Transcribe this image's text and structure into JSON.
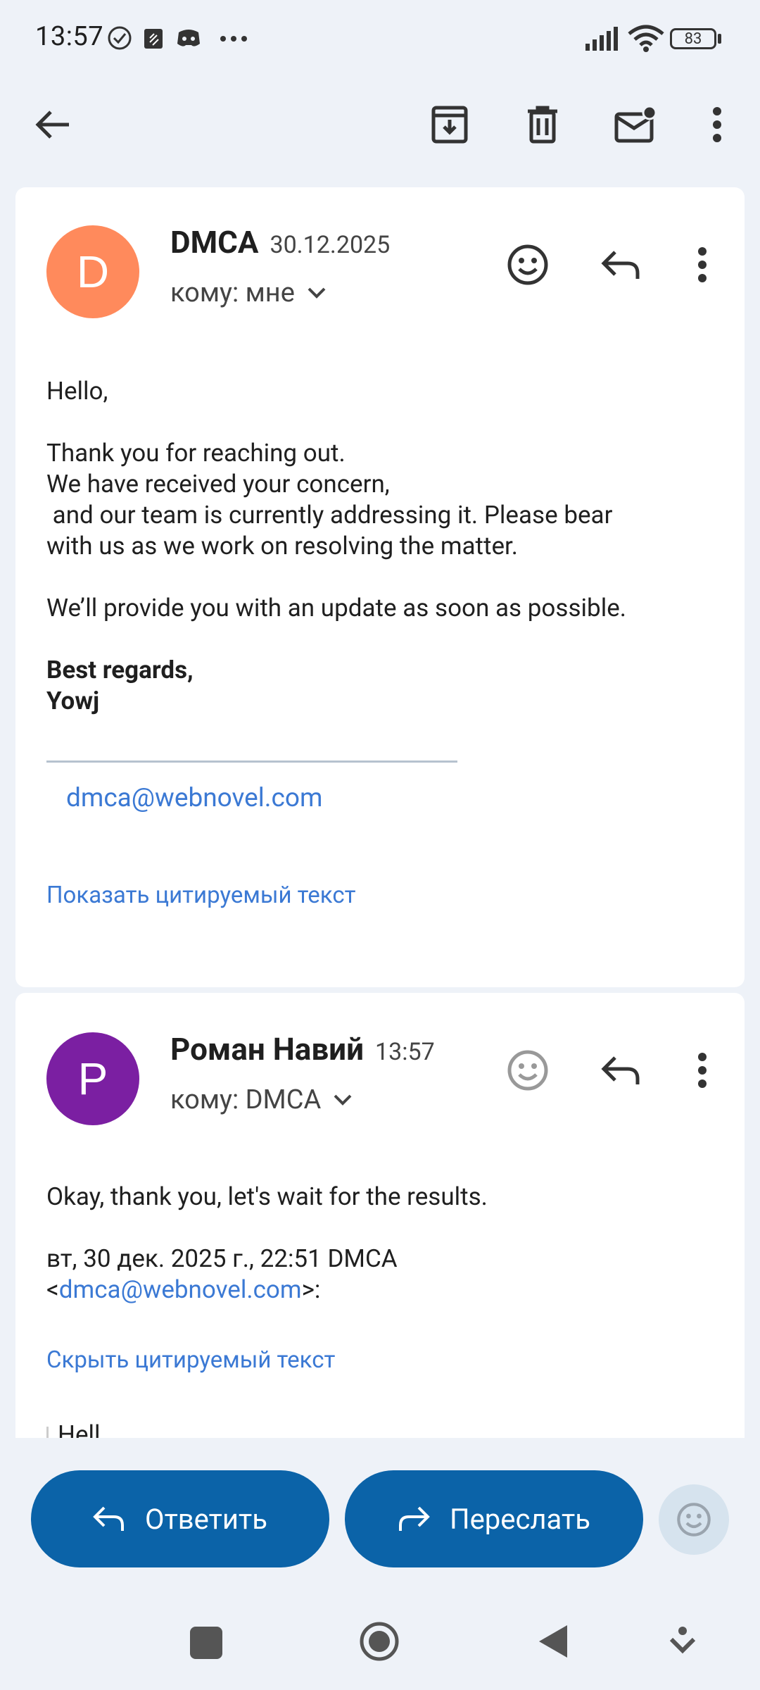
{
  "status_bar": {
    "time": "13:57",
    "battery": "83",
    "icons": [
      "check-circle-icon",
      "notification-app-icon",
      "discord-icon",
      "more-dots-icon",
      "signal-icon",
      "wifi-icon",
      "battery-icon"
    ]
  },
  "toolbar": {
    "icons": [
      "back-arrow-icon",
      "archive-icon",
      "delete-icon",
      "mark-unread-icon",
      "more-vert-icon"
    ]
  },
  "messages": [
    {
      "avatar_letter": "D",
      "avatar_color": "#ff8a5c",
      "sender": "DMCA",
      "date": "30.12.2025",
      "recipient": "кому: мне",
      "body": {
        "greeting": "Hello,",
        "line1": "Thank you for reaching out.",
        "line2": "We have received your concern,",
        "line3": " and our team is currently addressing it. Please bear",
        "line4": "with us as we work on resolving the matter.",
        "line5": "We’ll provide you with an update as soon as possible.",
        "signoff1": "Best regards,",
        "signoff2": "Yowj",
        "email": "dmca@webnovel.com"
      },
      "quoted_toggle": "Показать цитируемый текст"
    },
    {
      "avatar_letter": "P",
      "avatar_color": "#7b1fa2",
      "sender": "Роман Навий",
      "date": "13:57",
      "recipient": "кому: DMCA",
      "body": {
        "line1": "Okay, thank you, let's wait for the results.",
        "quote_header1": "вт, 30 дек. 2025 г., 22:51 DMCA",
        "quote_lt": "<",
        "quote_email": "dmca@webnovel.com",
        "quote_gt": ">:",
        "quoted_start": "Hell"
      },
      "quoted_toggle": "Скрыть цитируемый текст"
    }
  ],
  "actions": {
    "reply_label": "Ответить",
    "forward_label": "Переслать"
  },
  "colors": {
    "accent": "#0b63a8",
    "link": "#3b79d4",
    "background": "#eef2f8"
  }
}
